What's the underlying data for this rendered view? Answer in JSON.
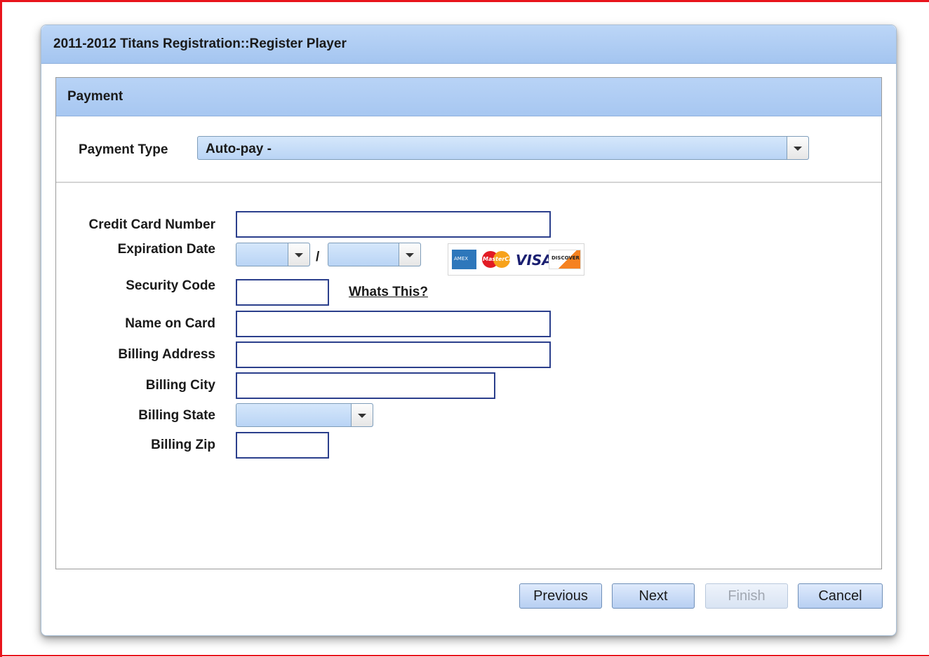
{
  "dialog": {
    "title": "2011-2012 Titans Registration::Register Player"
  },
  "panel": {
    "title": "Payment"
  },
  "payment_type": {
    "label": "Payment Type",
    "value": "Auto-pay -"
  },
  "form": {
    "credit_card_number_label": "Credit Card Number",
    "expiration_date_label": "Expiration Date",
    "expiration_separator": "/",
    "expiration_month_value": "",
    "expiration_year_value": "",
    "security_code_label": "Security Code",
    "whats_this_link": "Whats This?",
    "name_on_card_label": "Name on Card",
    "billing_address_label": "Billing Address",
    "billing_city_label": "Billing City",
    "billing_state_label": "Billing State",
    "billing_state_value": "",
    "billing_zip_label": "Billing Zip"
  },
  "accepted_cards": [
    "amex-icon",
    "mastercard-icon",
    "visa-icon",
    "discover-icon"
  ],
  "card_text": {
    "mastercard": "MasterCard",
    "visa": "VISA",
    "discover": "DISCOVER"
  },
  "buttons": {
    "previous": "Previous",
    "next": "Next",
    "finish": "Finish",
    "cancel": "Cancel"
  },
  "colors": {
    "accent": "#a4c5f0",
    "input_border": "#2b3f8c",
    "frame": "#e8141c"
  }
}
